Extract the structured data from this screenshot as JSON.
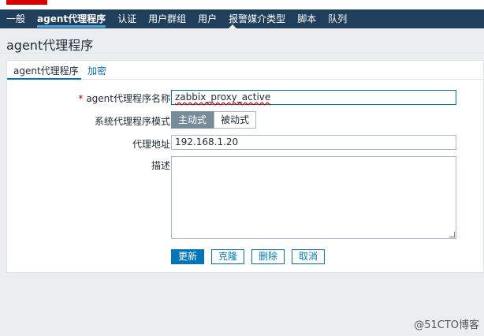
{
  "nav": {
    "items": [
      {
        "label": "一般",
        "active": false
      },
      {
        "label": "agent代理程序",
        "active": true
      },
      {
        "label": "认证",
        "active": false
      },
      {
        "label": "用户群组",
        "active": false
      },
      {
        "label": "用户",
        "active": false
      },
      {
        "label": "报警媒介类型",
        "active": false
      },
      {
        "label": "脚本",
        "active": false
      },
      {
        "label": "队列",
        "active": false
      }
    ]
  },
  "page": {
    "title": "agent代理程序"
  },
  "tabs": {
    "agent": "agent代理程序",
    "encryption": "加密"
  },
  "form": {
    "name_label": "agent代理程序名称",
    "name_value": "zabbix_proxy_active",
    "mode_label": "系统代理程序模式",
    "mode_options": [
      "主动式",
      "被动式"
    ],
    "mode_selected": "主动式",
    "address_label": "代理地址",
    "address_value": "192.168.1.20",
    "description_label": "描述",
    "description_value": ""
  },
  "buttons": {
    "update": "更新",
    "clone": "克隆",
    "delete": "删除",
    "cancel": "取消"
  },
  "watermark": "@51CTO博客",
  "colors": {
    "nav_bg": "#1f3f5a",
    "accent": "#0275b8",
    "selected_mode": "#768d99",
    "required": "#d40000"
  }
}
